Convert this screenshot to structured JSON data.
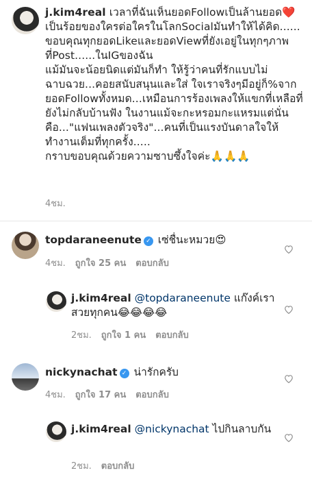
{
  "post": {
    "username": "j.kim4real",
    "caption": "เวลาที่ฉันเห็นยอดFollowเป็นล้านยอด❤️\nเป็นร้อยของใครต่อใครในโลกSocialมันทำให้ได้คิด......\nขอบคุณทุกยอดLikeและยอดViewที่ยังเอยู่ในทุกๆภาพที่Post......ในIGของฉัน\nแม้มันจะน้อยนิดแต่มันก็ทำ ให้รู้ว่าคนที่รักแบบไม่ฉาบฉวย...คอยสนับสนุนและใส่ ใจเราจริงๆมีอยู่ก็%จากยอดFollowทั้งหมด...เหมือนการร้องเพลงให้แขกที่เหลือที่ยังไม่กลับบ้านฟัง ในงานแม้จะกะหรอมกะแหรมแต่นั่นคือ...\"แฟนเพลงตัวจริง\"...คนที่เป็นแรงบันดาลใจให้ทำงานเต็มที่ทุกครั้ง.....\nกราบขอบคุณด้วยความซาบซึ้งใจค่ะ🙏🙏🙏",
    "time": "4ชม."
  },
  "comments": [
    {
      "username": "topdaraneenute",
      "verified": true,
      "text": " เซ่ชื่นะหมวย😍",
      "time": "4ชม.",
      "likes": "ถูกใจ 25 คน",
      "reply": "ตอบกลับ"
    },
    {
      "username": "j.kim4real",
      "mention": "@topdaraneenute",
      "text": " แก๊งค์เราสวยทุกคน😂😂😂😂",
      "time": "2ชม.",
      "likes": "ถูกใจ 1 คน",
      "reply": "ตอบกลับ"
    },
    {
      "username": "nickynachat",
      "verified": true,
      "text": " น่ารักครับ",
      "time": "4ชม.",
      "likes": "ถูกใจ 17 คน",
      "reply": "ตอบกลับ"
    },
    {
      "username": "j.kim4real",
      "mention": "@nickynachat",
      "text": " ไปกินลาบกัน",
      "time": "2ชม.",
      "reply": "ตอบกลับ"
    }
  ],
  "icons": {
    "verified": "✓",
    "heart": "heart-outline-icon"
  }
}
